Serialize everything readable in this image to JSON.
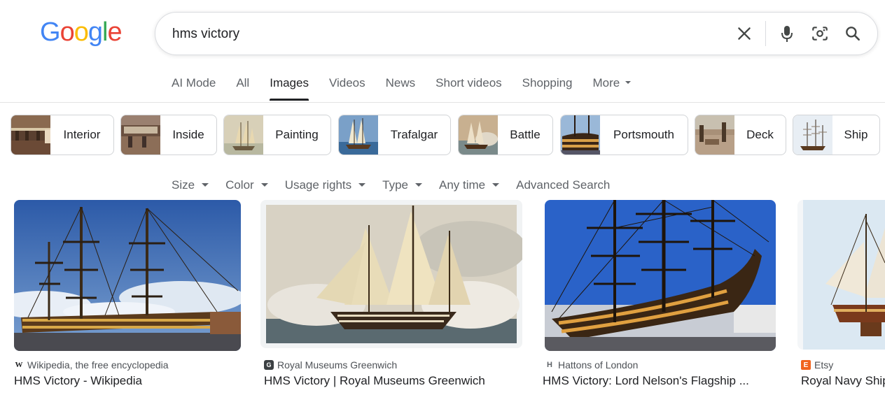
{
  "logo": {
    "letters": [
      "G",
      "o",
      "o",
      "g",
      "l",
      "e"
    ],
    "colors": [
      "#4285F4",
      "#EA4335",
      "#FBBC05",
      "#4285F4",
      "#34A853",
      "#EA4335"
    ]
  },
  "search": {
    "query": "hms victory"
  },
  "tabs": [
    {
      "label": "AI Mode"
    },
    {
      "label": "All"
    },
    {
      "label": "Images",
      "active": true
    },
    {
      "label": "Videos"
    },
    {
      "label": "News"
    },
    {
      "label": "Short videos"
    },
    {
      "label": "Shopping"
    },
    {
      "label": "More"
    }
  ],
  "chips": [
    {
      "label": "Interior"
    },
    {
      "label": "Inside"
    },
    {
      "label": "Painting"
    },
    {
      "label": "Trafalgar"
    },
    {
      "label": "Battle"
    },
    {
      "label": "Portsmouth"
    },
    {
      "label": "Deck"
    },
    {
      "label": "Ship"
    }
  ],
  "filters": [
    {
      "label": "Size"
    },
    {
      "label": "Color"
    },
    {
      "label": "Usage rights"
    },
    {
      "label": "Type"
    },
    {
      "label": "Any time"
    },
    {
      "label": "Advanced Search"
    }
  ],
  "results": [
    {
      "source": "Wikipedia, the free encyclopedia",
      "favicon": "W",
      "title": "HMS Victory - Wikipedia"
    },
    {
      "source": "Royal Museums Greenwich",
      "favicon": "G",
      "title": "HMS Victory | Royal Museums Greenwich"
    },
    {
      "source": "Hattons of London",
      "favicon": "H",
      "title": "HMS Victory: Lord Nelson's Flagship ..."
    },
    {
      "source": "Etsy",
      "favicon": "E",
      "title": "Royal Navy Ship"
    }
  ]
}
